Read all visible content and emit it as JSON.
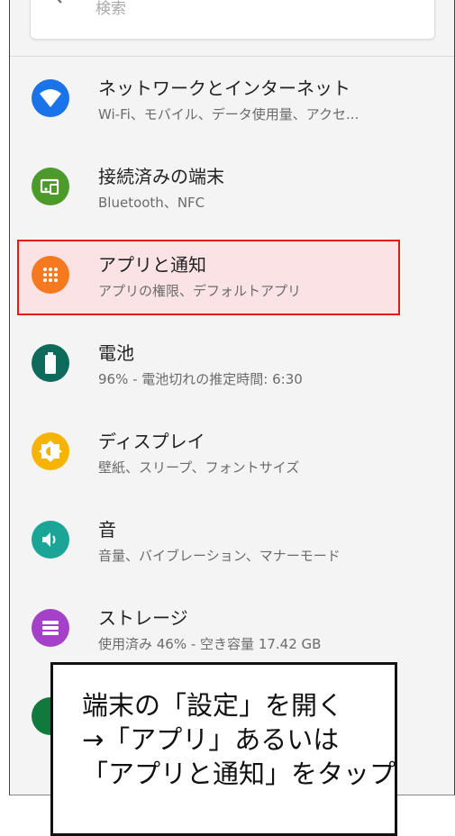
{
  "search": {
    "placeholder": "検索"
  },
  "items": [
    {
      "title": "ネットワークとインターネット",
      "subtitle": "Wi-Fi、モバイル、データ使用量、アクセ...",
      "icon": "wifi-icon",
      "color": "#1a73e8"
    },
    {
      "title": "接続済みの端末",
      "subtitle": "Bluetooth、NFC",
      "icon": "connected-devices-icon",
      "color": "#4c9a2a"
    },
    {
      "title": "アプリと通知",
      "subtitle": "アプリの権限、デフォルトアプリ",
      "icon": "apps-icon",
      "color": "#f4791f"
    },
    {
      "title": "電池",
      "subtitle": "96% - 電池切れの推定時間: 6:30",
      "icon": "battery-icon",
      "color": "#0e6b5c"
    },
    {
      "title": "ディスプレイ",
      "subtitle": "壁紙、スリープ、フォントサイズ",
      "icon": "display-brightness-icon",
      "color": "#f6b400"
    },
    {
      "title": "音",
      "subtitle": "音量、バイブレーション、マナーモード",
      "icon": "sound-icon",
      "color": "#1aa596"
    },
    {
      "title": "ストレージ",
      "subtitle": "使用済み 46% - 空き容量 17.42 GB",
      "icon": "storage-icon",
      "color": "#a540c8"
    }
  ],
  "colors": {
    "highlight_border": "#e01b1b",
    "highlight_fill": "#fbe3e5"
  },
  "callout": {
    "line1": "端末の「設定」を開く",
    "line2": "→「アプリ」あるいは",
    "line3": "「アプリと通知」をタップ"
  }
}
